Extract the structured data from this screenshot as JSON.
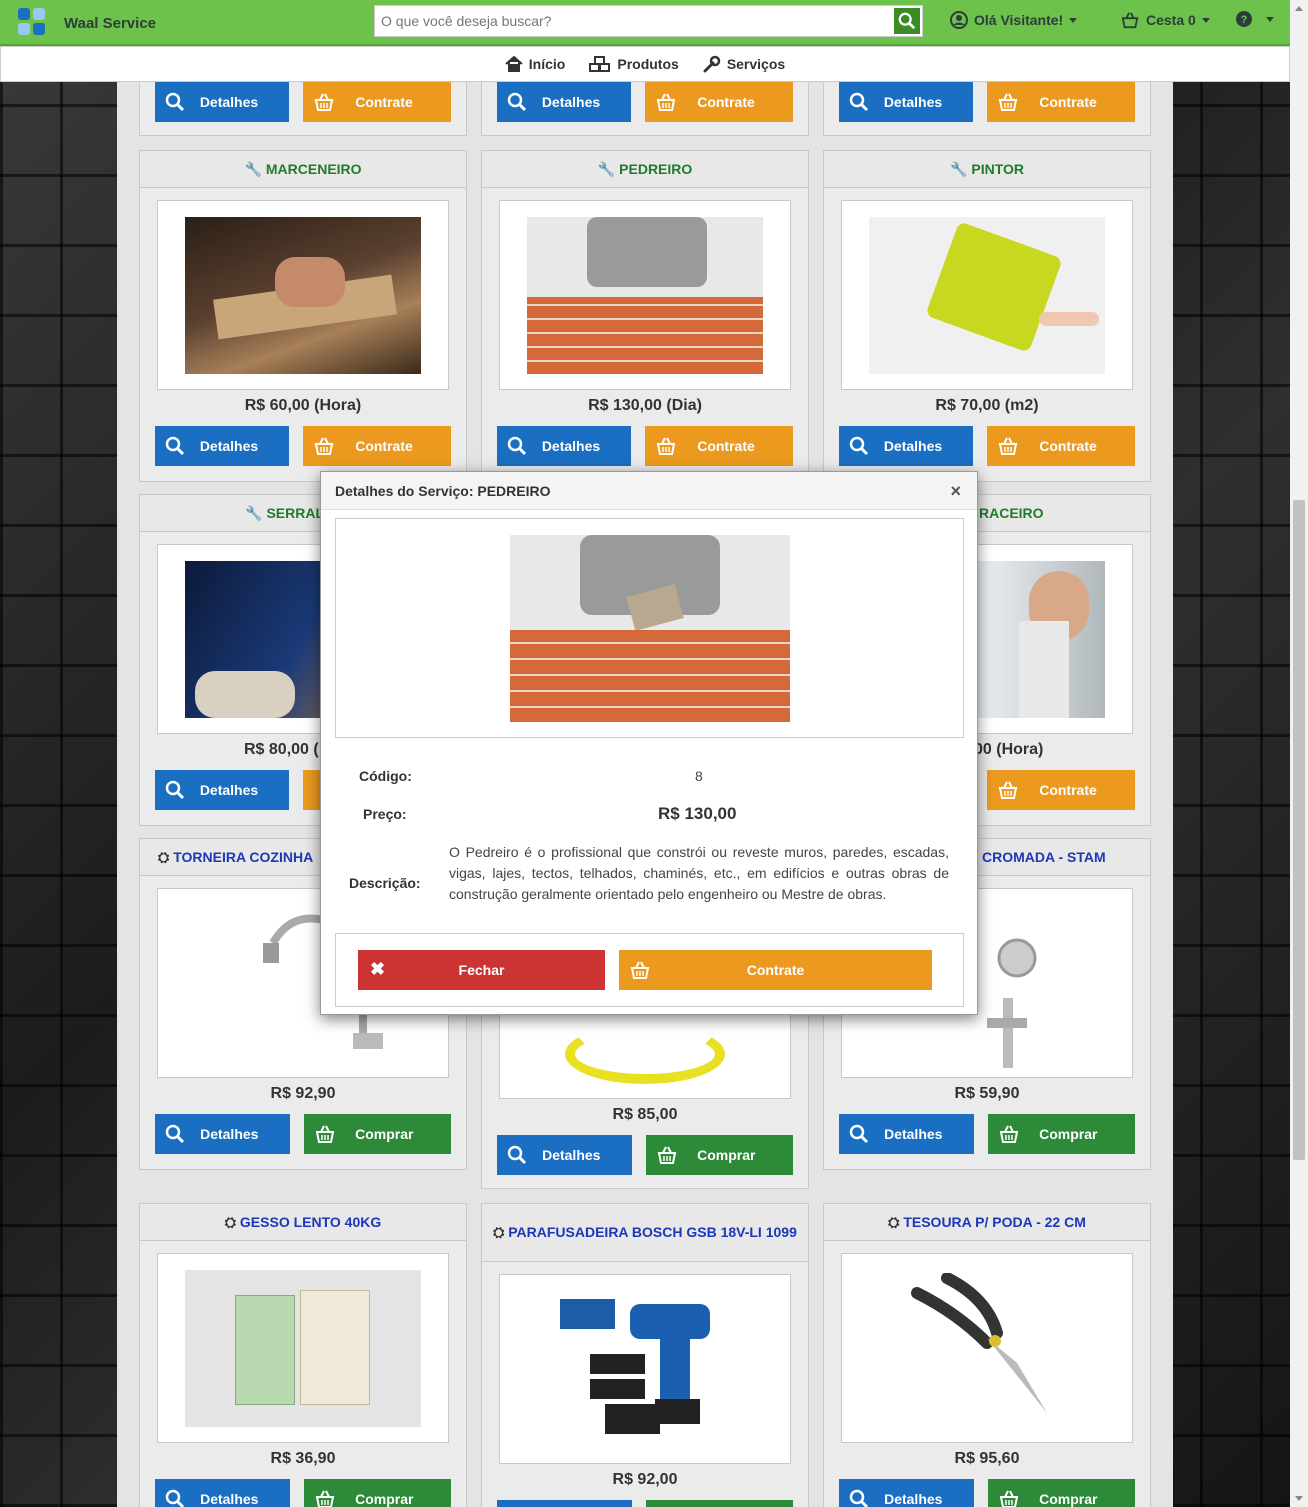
{
  "header": {
    "brand": "Waal Service",
    "search_placeholder": "O que você deseja buscar?",
    "user": "Olá Visitante!",
    "cart": "Cesta 0",
    "help_icon": "question-circle-icon"
  },
  "menu": {
    "home": "Início",
    "products": "Produtos",
    "services": "Serviços"
  },
  "buttons": {
    "details": "Detalhes",
    "hire": "Contrate",
    "buy": "Comprar"
  },
  "cards": {
    "marceneiro": {
      "title": "MARCENEIRO",
      "price": "R$ 60,00 (Hora)"
    },
    "pedreiro": {
      "title": "PEDREIRO",
      "price": "R$ 130,00 (Dia)"
    },
    "pintor": {
      "title": "PINTOR",
      "price": "R$ 70,00 (m2)"
    },
    "serralheiro": {
      "title": "SERRALI",
      "price": "R$ 80,00 ("
    },
    "vidraceiro": {
      "title": "RACEIRO",
      "price": "00 (Hora)"
    },
    "torneira": {
      "title": "TORNEIRA COZINHA",
      "price": "R$ 92,90"
    },
    "fio": {
      "price": "R$ 85,00"
    },
    "fechadura": {
      "title": "CROMADA - STAM",
      "price": "R$ 59,90"
    },
    "gesso": {
      "title": "GESSO LENTO 40KG",
      "price": "R$ 36,90"
    },
    "parafusadeira": {
      "title": "PARAFUSADEIRA BOSCH GSB 18V-LI 1099",
      "price": "R$ 92,00"
    },
    "tesoura": {
      "title": "TESOURA P/ PODA - 22 CM",
      "price": "R$ 95,60"
    }
  },
  "modal": {
    "title": "Detalhes do Serviço: PEDREIRO",
    "code_label": "Código:",
    "code": "8",
    "price_label": "Preço:",
    "price": "R$ 130,00",
    "desc_label": "Descrição:",
    "description": "O Pedreiro é o profissional que constrói ou reveste muros, paredes, escadas, vigas, lajes, tectos, telhados, chaminés, etc., em edifícios e outras obras de construção geralmente orientado pelo engenheiro ou Mestre de obras.",
    "close_btn": "Fechar",
    "hire_btn": "Contrate",
    "close_x": "×"
  },
  "colors": {
    "header_green": "#6cc24a",
    "detail_blue": "#1a6fc2",
    "hire_orange": "#ec9a1f",
    "buy_green": "#2c8a38",
    "close_red": "#cc3333",
    "service_title": "#1e7c2a",
    "product_title": "#1c38b8"
  }
}
